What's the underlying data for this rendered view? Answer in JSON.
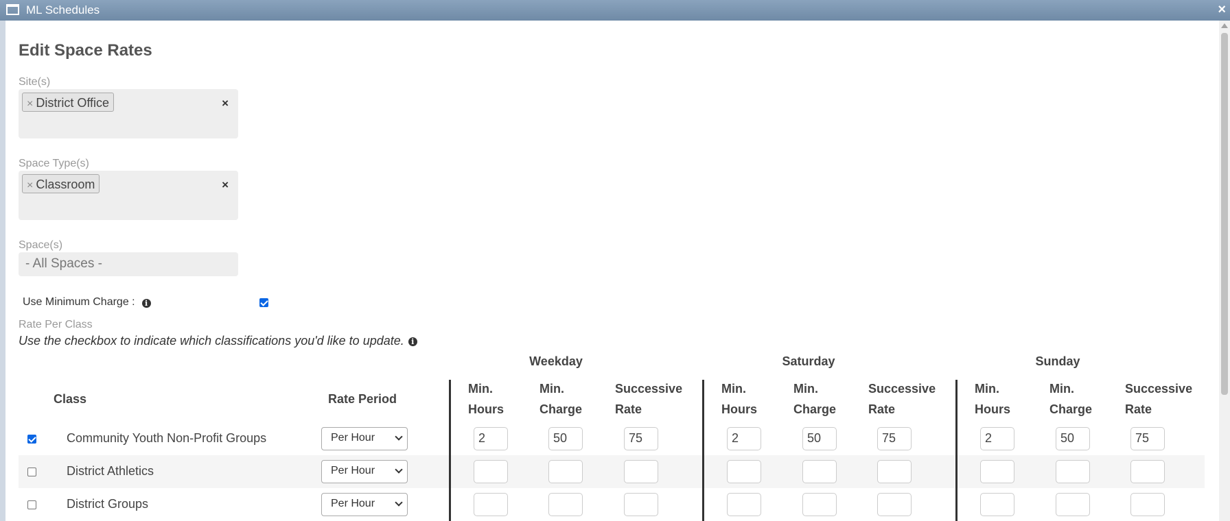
{
  "window": {
    "title": "ML Schedules"
  },
  "form": {
    "heading": "Edit Space Rates",
    "sites_label": "Site(s)",
    "sites_selected": [
      "District Office"
    ],
    "space_types_label": "Space Type(s)",
    "space_types_selected": [
      "Classroom"
    ],
    "spaces_label": "Space(s)",
    "spaces_placeholder": "- All Spaces -",
    "use_min_charge_label": "Use Minimum Charge :",
    "use_min_charge_checked": true,
    "rate_per_class_label": "Rate Per Class",
    "rate_hint": "Use the checkbox to indicate which classifications you'd like to update.",
    "remove_tag_glyph": "×",
    "clear_glyph": "×",
    "info_glyph": "i"
  },
  "table": {
    "groups": [
      "Weekday",
      "Saturday",
      "Sunday"
    ],
    "col_class": "Class",
    "col_rate_period": "Rate Period",
    "sub_headers": [
      [
        "Min.",
        "Hours"
      ],
      [
        "Min.",
        "Charge"
      ],
      [
        "Successive",
        "Rate"
      ]
    ],
    "rows": [
      {
        "class": "Community Youth Non-Profit Groups",
        "checked": true,
        "rate_period": "Per Hour",
        "values": [
          "2",
          "50",
          "75",
          "2",
          "50",
          "75",
          "2",
          "50",
          "75"
        ]
      },
      {
        "class": "District Athletics",
        "checked": false,
        "rate_period": "Per Hour",
        "values": [
          "",
          "",
          "",
          "",
          "",
          "",
          "",
          "",
          ""
        ]
      },
      {
        "class": "District Groups",
        "checked": false,
        "rate_period": "Per Hour",
        "values": [
          "",
          "",
          "",
          "",
          "",
          "",
          "",
          "",
          ""
        ]
      }
    ]
  }
}
